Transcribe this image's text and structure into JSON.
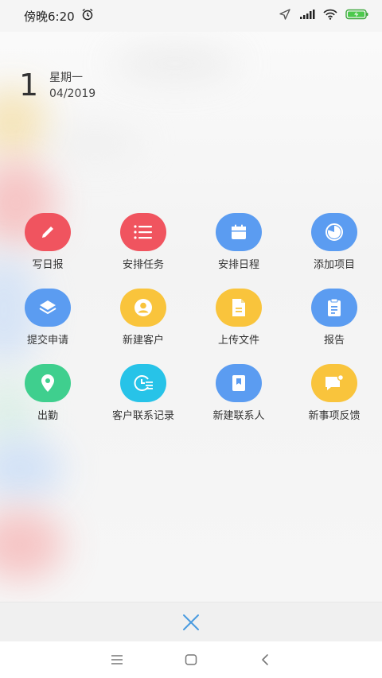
{
  "status_bar": {
    "time": "傍晚6:20",
    "icons": [
      "alarm-icon",
      "location-icon",
      "signal-icon",
      "wifi-icon",
      "battery-charging-icon"
    ],
    "battery_color": "#4cc94c"
  },
  "date": {
    "day": "1",
    "weekday": "星期一",
    "month_year": "04/2019"
  },
  "actions": [
    {
      "label": "写日报",
      "icon": "pencil-icon",
      "color": "#f0545f"
    },
    {
      "label": "安排任务",
      "icon": "list-icon",
      "color": "#f0545f"
    },
    {
      "label": "安排日程",
      "icon": "calendar-icon",
      "color": "#5b9cf1"
    },
    {
      "label": "添加项目",
      "icon": "pie-chart-icon",
      "color": "#5b9cf1"
    },
    {
      "label": "提交申请",
      "icon": "layers-icon",
      "color": "#5b9cf1"
    },
    {
      "label": "新建客户",
      "icon": "user-icon",
      "color": "#f9c43c"
    },
    {
      "label": "上传文件",
      "icon": "document-icon",
      "color": "#f9c43c"
    },
    {
      "label": "报告",
      "icon": "clipboard-icon",
      "color": "#5b9cf1"
    },
    {
      "label": "出勤",
      "icon": "location-pin-icon",
      "color": "#3fcf8e"
    },
    {
      "label": "客户联系记录",
      "icon": "clock-list-icon",
      "color": "#27c3e8"
    },
    {
      "label": "新建联系人",
      "icon": "contact-book-icon",
      "color": "#5b9cf1"
    },
    {
      "label": "新事项反馈",
      "icon": "feedback-icon",
      "color": "#f9c43c"
    }
  ],
  "close_button": {
    "icon": "close-icon",
    "color": "#4a9be0"
  },
  "nav_bar": {
    "icons": [
      "menu-icon",
      "home-icon",
      "back-icon"
    ]
  }
}
